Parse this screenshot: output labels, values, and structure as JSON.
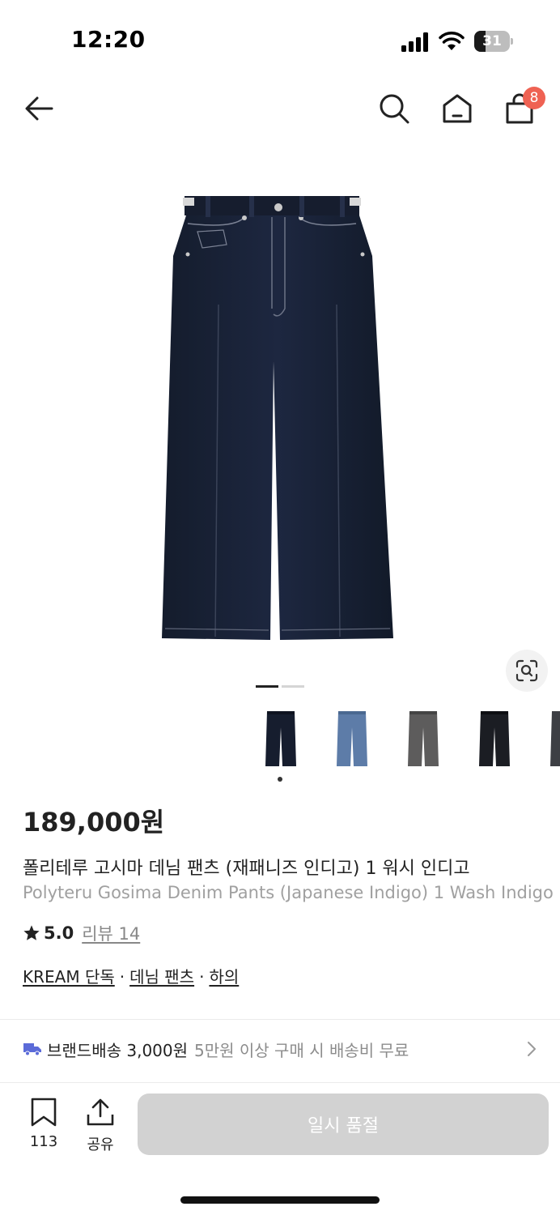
{
  "status_bar": {
    "time": "12:20",
    "battery_level": "31"
  },
  "nav": {
    "back_icon": "arrow-left-icon",
    "search_icon": "search-icon",
    "home_icon": "home-icon",
    "cart_icon": "shopping-bag-icon",
    "cart_count": "8",
    "badge_color": "#ef6253"
  },
  "gallery": {
    "current_page": 1,
    "total_pages": 2,
    "thumbnails": [
      {
        "color_name": "indigo-raw",
        "selected": true
      },
      {
        "color_name": "light-blue",
        "selected": false
      },
      {
        "color_name": "grey",
        "selected": false
      },
      {
        "color_name": "black",
        "selected": false
      },
      {
        "color_name": "dark-grey",
        "selected": false
      }
    ]
  },
  "product": {
    "price": "189,000원",
    "title_ko": "폴리테루 고시마 데님 팬츠 (재패니즈 인디고) 1 워시 인디고",
    "title_en": "Polyteru Gosima Denim Pants (Japanese Indigo) 1 Wash Indigo",
    "rating": "5.0",
    "review_label": "리뷰 14",
    "tags": [
      "KREAM 단독",
      "데님 팬츠",
      "하의"
    ],
    "tag_separator": "·"
  },
  "shipping": {
    "main": "브랜드배송 3,000원",
    "sub": "5만원 이상 구매 시 배송비 무료",
    "icon_color": "#5b6bd8"
  },
  "bottom_bar": {
    "bookmark_count": "113",
    "share_label": "공유",
    "buy_label": "일시 품절",
    "buy_bg": "#d2d2d2"
  }
}
